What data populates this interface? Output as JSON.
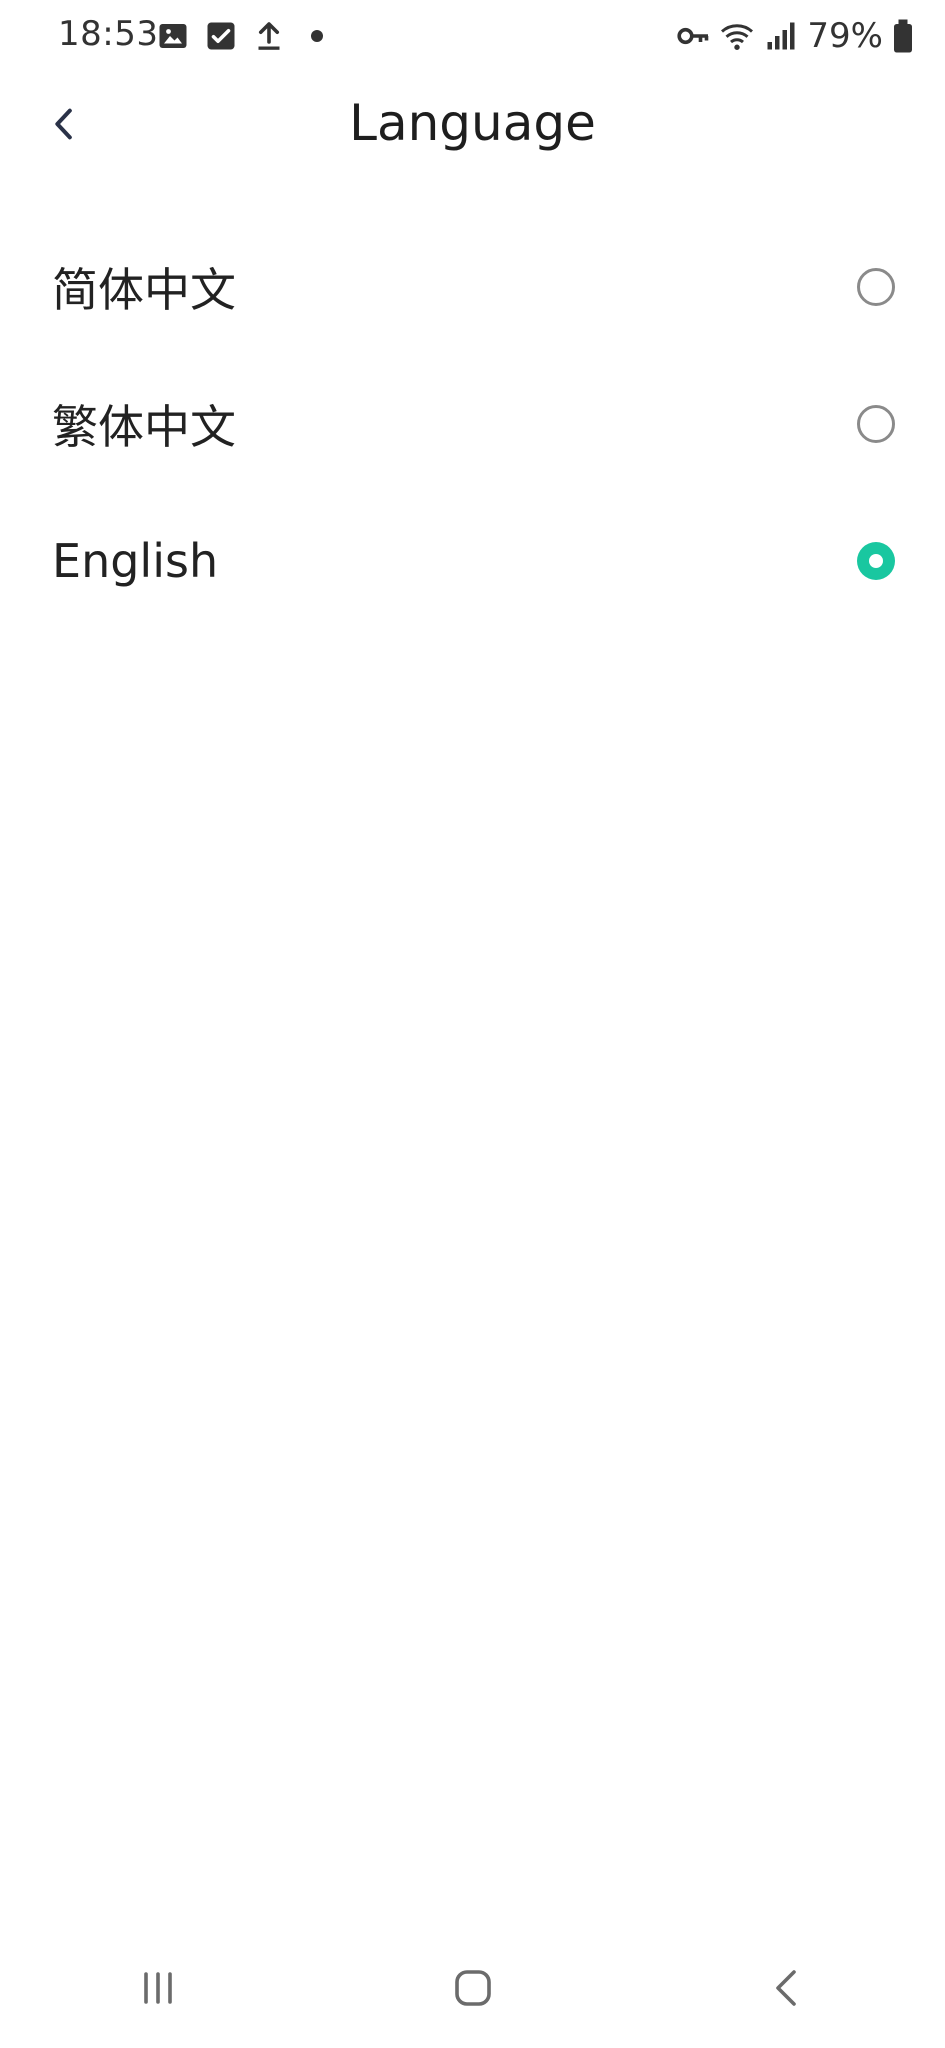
{
  "status_bar": {
    "time": "18:53",
    "battery_percent": "79%",
    "left_icons": [
      "gallery-icon",
      "checkbox-icon",
      "upload-icon",
      "dot-icon"
    ],
    "right_icons": [
      "vpn-key-icon",
      "wifi-icon",
      "signal-icon",
      "battery-icon"
    ]
  },
  "app_bar": {
    "title": "Language",
    "back_icon": "chevron-left-icon"
  },
  "languages": [
    {
      "label": "简体中文",
      "selected": false
    },
    {
      "label": "繁体中文",
      "selected": false
    },
    {
      "label": "English",
      "selected": true
    }
  ],
  "accent_color": "#19c7a0",
  "navigation": {
    "recent_icon": "recent-apps-icon",
    "home_icon": "home-icon",
    "back_icon": "back-icon"
  }
}
